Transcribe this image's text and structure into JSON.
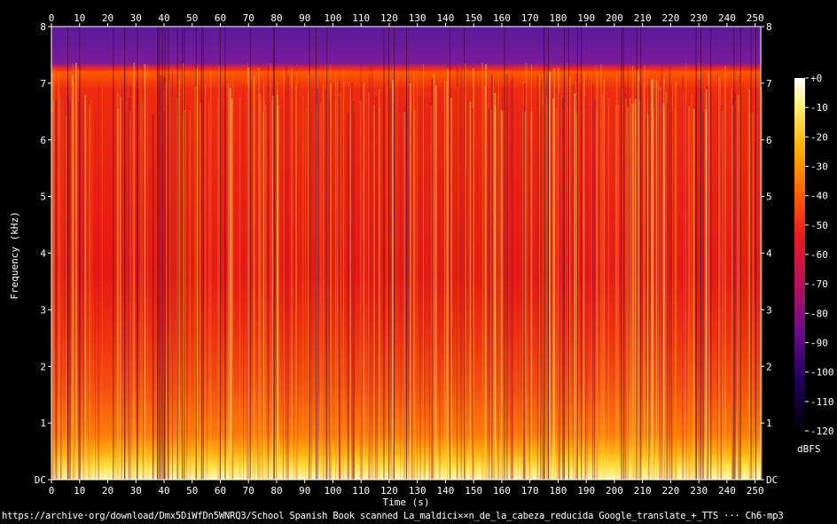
{
  "chart_data": {
    "type": "heatmap",
    "xlabel": "Time (s)",
    "ylabel": "Frequency (kHz)",
    "x_ticks": [
      0,
      10,
      20,
      30,
      40,
      50,
      60,
      70,
      80,
      90,
      100,
      110,
      120,
      130,
      140,
      150,
      160,
      170,
      180,
      190,
      200,
      210,
      220,
      230,
      240,
      250
    ],
    "xlim": [
      0,
      252
    ],
    "y_ticks": [
      {
        "value": 0,
        "label": "DC"
      },
      {
        "value": 1,
        "label": "1"
      },
      {
        "value": 2,
        "label": "2"
      },
      {
        "value": 3,
        "label": "3"
      },
      {
        "value": 4,
        "label": "4"
      },
      {
        "value": 5,
        "label": "5"
      },
      {
        "value": 6,
        "label": "6"
      },
      {
        "value": 7,
        "label": "7"
      },
      {
        "value": 8,
        "label": "8"
      }
    ],
    "ylim": [
      0,
      8
    ],
    "colorbar": {
      "unit": "dBFS",
      "ticks": [
        "+0",
        "-10",
        "-20",
        "-30",
        "-40",
        "-50",
        "-60",
        "-70",
        "-80",
        "-90",
        "-100",
        "-110",
        "-120"
      ],
      "range": [
        -120,
        0
      ],
      "colors": [
        "#000000",
        "#1a0050",
        "#5a0c8c",
        "#a0106e",
        "#e0202a",
        "#ff5a00",
        "#ffa500",
        "#ffe040",
        "#ffffff"
      ]
    },
    "description_levels": {
      "0-0.5kHz": -5,
      "0.5-1.5kHz": -30,
      "1.5-3kHz": -40,
      "3-7.2kHz": -45,
      "7.2-8kHz": -80
    }
  },
  "footer_text": "https://archive·org/download/Dmx5DiWfDn5WNRQ3/School Spanish Book scanned La_maldici××n_de_la_cabeza_reducida Google_translate_+_TTS ··· Ch6·mp3"
}
